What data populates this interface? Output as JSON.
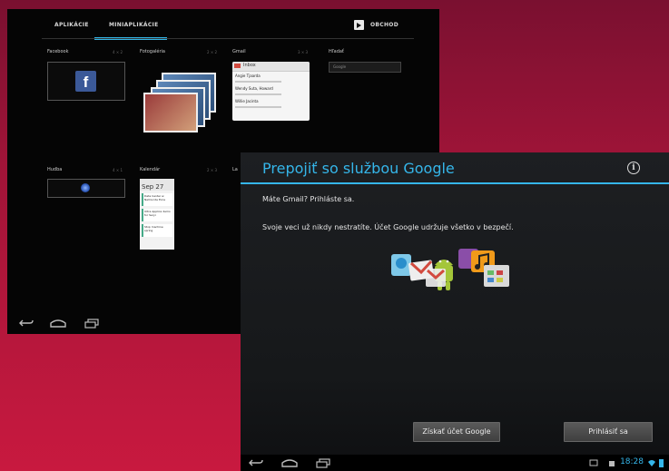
{
  "back_tablet": {
    "tabs": [
      "APLIKÁCIE",
      "MINIAPLIKÁCIE"
    ],
    "store_label": "OBCHOD",
    "widgets": [
      {
        "name": "Facebook",
        "dims": "4 × 2"
      },
      {
        "name": "Fotogaléria",
        "dims": "2 × 2"
      },
      {
        "name": "Gmail",
        "dims": "3 × 3"
      },
      {
        "name": "Hľadať",
        "dims": ""
      },
      {
        "name": "Hudba",
        "dims": "4 × 1"
      },
      {
        "name": "Kalendár",
        "dims": "2 × 3"
      },
      {
        "name": "La",
        "dims": ""
      }
    ],
    "gmail_preview": {
      "header": "Inbox",
      "senders": [
        "Angie Tjaarda",
        "Wendy Suta, Howard",
        "Willie Jacinta"
      ]
    },
    "search_hint": "Google",
    "calendar": {
      "date": "Sep 27",
      "events": [
        "Data Center w Nelms Ide Exce",
        "Ultra Applica demo for Seryi",
        "Stop machine spring"
      ]
    }
  },
  "dialog": {
    "title": "Prepojiť so službou Google",
    "line1": "Máte Gmail? Prihláste sa.",
    "line2": "Svoje veci už nikdy nestratíte. Účet Google udržuje všetko v bezpečí.",
    "btn_create": "Získať účet Google",
    "btn_signin": "Prihlásiť sa",
    "clock": "18:28"
  },
  "colors": {
    "accent": "#35b6ea",
    "background": "#c8193f"
  },
  "icons": [
    "back-icon",
    "home-icon",
    "recent-apps-icon",
    "info-icon",
    "store-icon",
    "facebook-icon",
    "wifi-icon",
    "battery-icon"
  ]
}
